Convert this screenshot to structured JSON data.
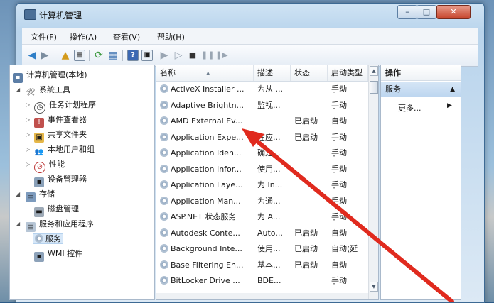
{
  "window": {
    "title": "计算机管理",
    "controls": {
      "minimize": "–",
      "maximize": "□",
      "close": "✕"
    }
  },
  "menu": [
    "文件(F)",
    "操作(A)",
    "查看(V)",
    "帮助(H)"
  ],
  "tree": {
    "root": "计算机管理(本地)",
    "items": [
      {
        "label": "系统工具",
        "level": 1,
        "expander": "◢"
      },
      {
        "label": "任务计划程序",
        "level": 2,
        "expander": "▷"
      },
      {
        "label": "事件查看器",
        "level": 2,
        "expander": "▷"
      },
      {
        "label": "共享文件夹",
        "level": 2,
        "expander": "▷"
      },
      {
        "label": "本地用户和组",
        "level": 2,
        "expander": "▷"
      },
      {
        "label": "性能",
        "level": 2,
        "expander": "▷"
      },
      {
        "label": "设备管理器",
        "level": 2,
        "expander": ""
      },
      {
        "label": "存储",
        "level": 1,
        "expander": "◢"
      },
      {
        "label": "磁盘管理",
        "level": 2,
        "expander": ""
      },
      {
        "label": "服务和应用程序",
        "level": 1,
        "expander": "◢"
      },
      {
        "label": "服务",
        "level": 2,
        "expander": "",
        "selected": true
      },
      {
        "label": "WMI 控件",
        "level": 2,
        "expander": ""
      }
    ]
  },
  "list": {
    "columns": [
      "名称",
      "描述",
      "状态",
      "启动类型"
    ],
    "rows": [
      [
        "ActiveX Installer ...",
        "为从 ...",
        "",
        "手动"
      ],
      [
        "Adaptive Brightn...",
        "监视...",
        "",
        "手动"
      ],
      [
        "AMD External Ev...",
        "",
        "已启动",
        "自动"
      ],
      [
        "Application Expe...",
        "在应...",
        "已启动",
        "手动"
      ],
      [
        "Application Iden...",
        "确定...",
        "",
        "手动"
      ],
      [
        "Application Infor...",
        "使用...",
        "",
        "手动"
      ],
      [
        "Application Laye...",
        "为 In...",
        "",
        "手动"
      ],
      [
        "Application Man...",
        "为通...",
        "",
        "手动"
      ],
      [
        "ASP.NET 状态服务",
        "为 A...",
        "",
        "手动"
      ],
      [
        "Autodesk Conte...",
        "Auto...",
        "已启动",
        "自动"
      ],
      [
        "Background Inte...",
        "使用...",
        "已启动",
        "自动(延"
      ],
      [
        "Base Filtering En...",
        "基本...",
        "已启动",
        "自动"
      ],
      [
        "BitLocker Drive ...",
        "BDE...",
        "",
        "手动"
      ]
    ]
  },
  "actions": {
    "header": "操作",
    "section": "服务",
    "more": "更多..."
  },
  "colors": {
    "annotation_arrow": "#e02a1e"
  }
}
